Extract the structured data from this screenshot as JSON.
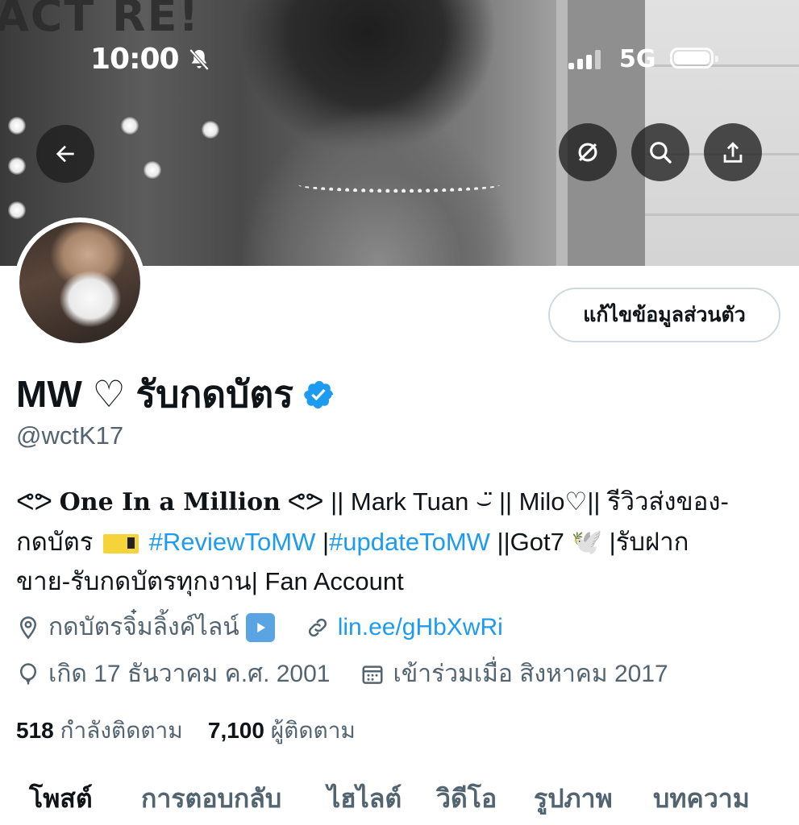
{
  "status_bar": {
    "time": "10:00",
    "network": "5G",
    "icons": [
      "bell-slash-icon",
      "cellular-signal-icon",
      "battery-icon"
    ]
  },
  "header": {
    "buttons": [
      "back-arrow-icon",
      "mute-icon",
      "search-icon",
      "share-icon"
    ]
  },
  "profile": {
    "edit_button": "แก้ไขข้อมูลส่วนตัว",
    "display_name": "MW ♡ รับกดบัตร",
    "verified_icon": "verified-badge-icon",
    "handle": "@wctK17",
    "bio": {
      "part1": "ᕙᕗ",
      "one_in_a_million": "One In a Million",
      "part2": "ᕙᕗ || Mark Tuan ⌣̈ || Milo♡|| รีวิวส่งของ-",
      "part3": "กดบัตร",
      "hashtag1": "#ReviewToMW",
      "sep": " |",
      "hashtag2": "#updateToMW",
      "part4": " ||Got7 🕊️ |รับฝาก",
      "part5": "ขาย-รับกดบัตรทุกงาน| Fan Account"
    },
    "location": "กดบัตรจิ๋มลิ้งค์ไลน์",
    "website": "lin.ee/gHbXwRi",
    "birthday": "เกิด 17 ธันวาคม ค.ศ. 2001",
    "joined": "เข้าร่วมเมื่อ สิงหาคม 2017",
    "following_count": "518",
    "following_label": "กำลังติดตาม",
    "followers_count": "7,100",
    "followers_label": "ผู้ติดตาม"
  },
  "tabs": [
    {
      "label": "โพสต์",
      "active": true
    },
    {
      "label": "การตอบกลับ",
      "active": false
    },
    {
      "label": "ไฮไลต์",
      "active": false
    },
    {
      "label": "วิดีโอ",
      "active": false
    },
    {
      "label": "รูปภาพ",
      "active": false
    },
    {
      "label": "บทความ",
      "active": false
    }
  ],
  "colors": {
    "accent": "#1d9bf0",
    "secondary_text": "#536471",
    "primary_text": "#0f1419",
    "border": "#cfd9de"
  }
}
